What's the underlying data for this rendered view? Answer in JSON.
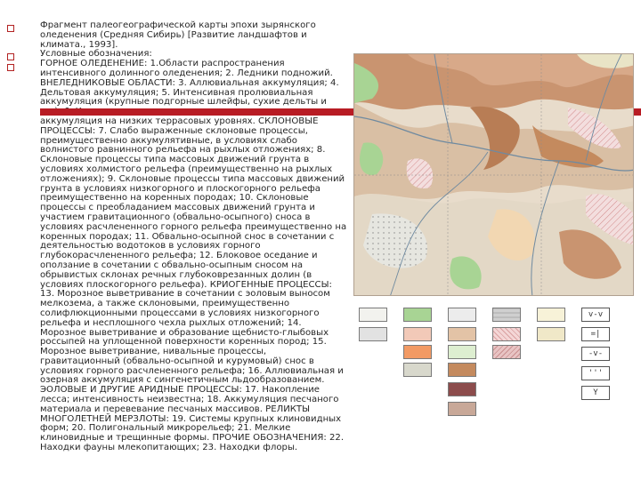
{
  "items": [
    "Фрагмент палеогеографической карты эпохи зырянского оледенения (Средняя Сибирь) [Развитие ландшафтов и климата., 1993].",
    "Условные обозначения:",
    "ГОРНОЕ ОЛЕДЕНЕНИЕ: 1.Области распространения интенсивного долинного оледенения; 2. Ледники подножий. ВНЕЛЕДНИКОВЫЕ ОБЛАСТИ: 3. Аллювиальная аккумуляция; 4. Дельтовая аккумуляция; 5. Интенсивная пролювиальная аккумуляция (крупные подгорные шлейфы, сухие дельты и пр.); 6. Комплексная делювиально-пролювиальная аккумуляция на низких террасовых уровнях. СКЛОНОВЫЕ ПРОЦЕССЫ: 7. Слабо выраженные склоновые процессы, преимущественно аккумулятивные, в условиях слабо волнистого равнинного рельефа на рыхлых отложениях; 8. Склоновые процессы типа массовых движений грунта в условиях холмистого рельефа (преимущественно на рыхлых отложениях); 9. Склоновые процессы типа массовых движений грунта в условиях низкогорного и плоскогорного рельефа преимущественно на коренных породах; 10. Склоновые процессы с преобладанием массовых движений грунта и участием гравитационного (обвально-осыпного) сноса в условиях расчлененного горного рельефа преимущественно на коренных породах; 11. Обвально-осыпной снос в сочетании с деятельностью водотоков в условиях горного глубокорасчлененного рельефа; 12. Блоковое оседание и оползание в сочетании с обвально-осыпным сносом на обрывистых склонах речных глубоковрезанных долин (в условиях плоскогорного рельефа). КРИОГЕННЫЕ ПРОЦЕССЫ: 13. Морозное выветривание в сочетании с эоловым выносом мелкозема, а также склоновыми, преимущественно солифлюкционными процессами в условиях низкогорного рельефа и несплошного чехла рыхлых отложений; 14. Морозное выветривание и образование щебнисто-глыбовых россыпей на уплощенной поверхности коренных пород; 15. Морозное выветривание, нивальные процессы, гравитационный (обвально-осыпной и курумовый) снос в условиях горного расчлененного рельефа; 16. Аллювиальная и озерная аккумуляция с сингенетичным льдообразованием. ЭОЛОВЫЕ И ДРУГИЕ АРИДНЫЕ ПРОЦЕССЫ: 17. Накопление лесса; интенсивность неизвестна; 18. Аккумуляция песчаного материала и перевевание песчаных массивов. РЕЛИКТЫ МНОГОЛЕТНЕЙ МЕРЗЛОТЫ: 19. Системы крупных клиновидных форм; 20. Полигональный микрорельеф; 21. Мелкие клиновидные и трещинные формы. ПРОЧИЕ ОБОЗНАЧЕНИЯ: 22. Находки фауны млекопитающих; 23. Находки флоры."
  ],
  "colors": {
    "accent_bar": "#b81c24",
    "bullet": "#b22222"
  },
  "legend": {
    "swatches": [
      "#f2f2ee",
      "#a8d494",
      "#ececec",
      "#cfcfcf",
      "#f7f2d8",
      "#e2e2e2",
      "#f2c9b8",
      "#e3c3a6",
      "#f4d6d6",
      "#f0e8c8",
      "#f29a64",
      "#ddeed0",
      "#c9a785",
      "#e8c4c4",
      "#d8d8cc",
      "#c48a5e",
      "#b87d55",
      "#8c4c4c",
      "#c8a898"
    ],
    "symbols": [
      "v-v",
      "=|",
      "-v-",
      "'''",
      "Y"
    ],
    "symbol_icons": [
      "wedge-symbol-icon",
      "polygon-symbol-icon",
      "triangle-symbol-icon",
      "crack-symbol-icon",
      "fauna-symbol-icon"
    ]
  }
}
